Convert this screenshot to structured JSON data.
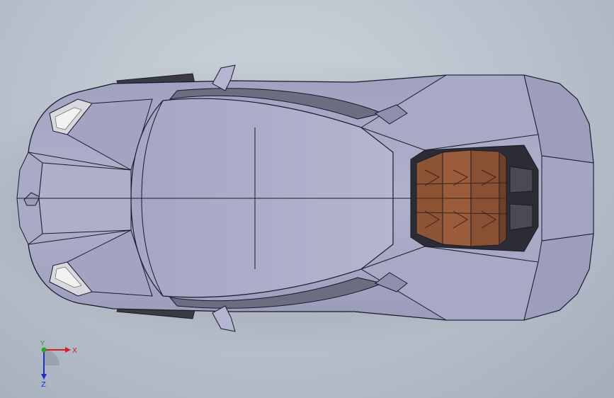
{
  "viewport": {
    "background": "#bcc4ce",
    "model": {
      "body_color": "#a7a9c4",
      "engine_cover_color": "#8a5236",
      "edge_color": "#1a1a2a"
    }
  },
  "triad": {
    "x_label": "X",
    "y_label": "Y",
    "z_label": "Z",
    "x_color": "#d32020",
    "y_color": "#22aa22",
    "z_color": "#2030c0"
  }
}
